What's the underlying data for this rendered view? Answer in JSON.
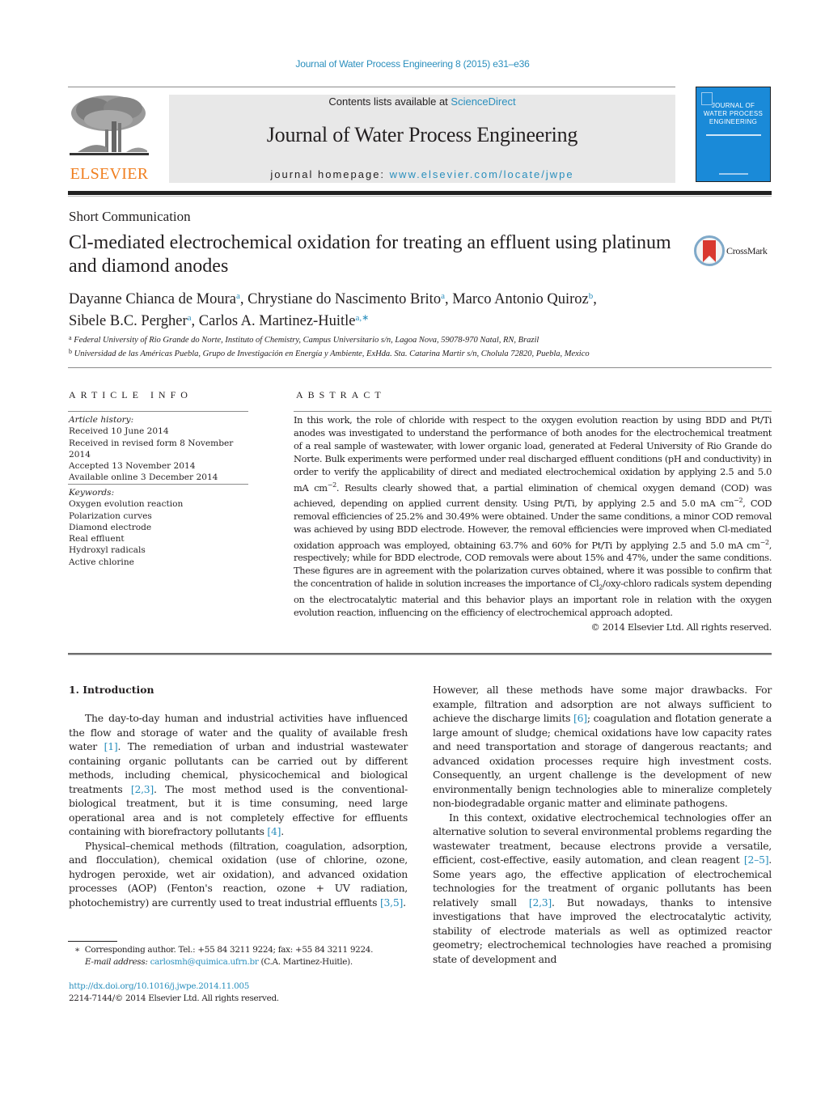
{
  "header": {
    "journal_reference": "Journal of Water Process Engineering 8 (2015) e31–e36",
    "contents_prefix": "Contents lists available at ",
    "contents_link": "ScienceDirect",
    "journal_name": "Journal of Water Process Engineering",
    "homepage_prefix": "journal homepage: ",
    "homepage_url": "www.elsevier.com/locate/jwpe",
    "publisher_logo_text": "ELSEVIER",
    "cover": {
      "title_line1": "JOURNAL OF",
      "title_line2": "WATER PROCESS",
      "title_line3": "ENGINEERING",
      "color": "#1a8ad8"
    },
    "crossmark_label": "CrossMark"
  },
  "article": {
    "type": "Short Communication",
    "title": "Cl-mediated electrochemical oxidation for treating an effluent using platinum and diamond anodes",
    "authors": [
      {
        "name": "Dayanne Chianca de Moura",
        "affil": "a",
        "sep": ", "
      },
      {
        "name": "Chrystiane do Nascimento Brito",
        "affil": "a",
        "sep": ", "
      },
      {
        "name": "Marco Antonio Quiroz",
        "affil": "b",
        "sep": ","
      },
      {
        "name": "Sibele B.C. Pergher",
        "affil": "a",
        "sep": ", "
      },
      {
        "name": "Carlos A. Martinez-Huitle",
        "affil": "a,∗",
        "sep": ""
      }
    ],
    "affiliations": [
      {
        "key": "a",
        "text": "Federal University of Rio Grande do Norte, Instituto of Chemistry, Campus Universitario s/n, Lagoa Nova, 59078-970 Natal, RN, Brazil"
      },
      {
        "key": "b",
        "text": "Universidad de las Américas Puebla, Grupo de Investigación en Energía y Ambiente, ExHda. Sta. Catarina Martir s/n, Cholula 72820, Puebla, Mexico"
      }
    ]
  },
  "article_info": {
    "heading": "ARTICLE INFO",
    "history_label": "Article history:",
    "history": [
      "Received 10 June 2014",
      "Received in revised form 8 November 2014",
      "Accepted 13 November 2014",
      "Available online 3 December 2014"
    ],
    "keywords_label": "Keywords:",
    "keywords": [
      "Oxygen evolution reaction",
      "Polarization curves",
      "Diamond electrode",
      "Real effluent",
      "Hydroxyl radicals",
      "Active chlorine"
    ]
  },
  "abstract": {
    "heading": "ABSTRACT",
    "parts": {
      "p1": "In this work, the role of chloride with respect to the oxygen evolution reaction by using BDD and Pt/Ti anodes was investigated to understand the performance of both anodes for the electrochemical treatment of a real sample of wastewater, with lower organic load, generated at Federal University of Rio Grande do Norte. Bulk experiments were performed under real discharged effluent conditions (pH and conductivity) in order to verify the applicability of direct and mediated electrochemical oxidation by applying 2.5 and 5.0 mA cm",
      "sup1": "−2",
      "p2": ". Results clearly showed that, a partial elimination of chemical oxygen demand (COD) was achieved, depending on applied current density. Using Pt/Ti, by applying 2.5 and 5.0 mA cm",
      "sup2": "−2",
      "p3": ", COD removal efficiencies of 25.2% and 30.49% were obtained. Under the same conditions, a minor COD removal was achieved by using BDD electrode. However, the removal efficiencies were improved when Cl-mediated oxidation approach was employed, obtaining 63.7% and 60% for Pt/Ti by applying 2.5 and 5.0 mA cm",
      "sup3": "−2",
      "p4": ", respectively; while for BDD electrode, COD removals were about 15% and 47%, under the same conditions. These figures are in agreement with the polarization curves obtained, where it was possible to confirm that the concentration of halide in solution increases the importance of Cl",
      "sub1": "2",
      "p5": "/oxy-chloro radicals system depending on the electrocatalytic material and this behavior plays an important role in relation with the oxygen evolution reaction, influencing on the efficiency of electrochemical approach adopted."
    },
    "copyright": "© 2014 Elsevier Ltd. All rights reserved."
  },
  "body": {
    "section_heading": "1.  Introduction",
    "left": {
      "para1": {
        "t1": "The day-to-day human and industrial activities have influenced the flow and storage of water and the quality of available fresh water ",
        "r1": "[1]",
        "t2": ". The remediation of urban and industrial wastewater containing organic pollutants can be carried out by different methods, including chemical, physicochemical and biological treatments ",
        "r2": "[2,3]",
        "t3": ". The most method used is the conventional-biological treatment, but it is time consuming, need large operational area and is not completely effective for effluents containing with biorefractory pollutants ",
        "r3": "[4]",
        "t4": "."
      },
      "para2": {
        "t1": "Physical–chemical methods (filtration, coagulation, adsorption, and flocculation), chemical oxidation (use of chlorine, ozone, hydrogen peroxide, wet air oxidation), and advanced oxidation processes (AOP) (Fenton's reaction, ozone + UV radiation, photochemistry) are currently used to treat industrial effluents ",
        "r1": "[3,5]",
        "t2": "."
      }
    },
    "right": {
      "para1": {
        "t1": "However, all these methods have some major drawbacks. For example, filtration and adsorption are not always sufficient to achieve the discharge limits ",
        "r1": "[6]",
        "t2": "; coagulation and flotation generate a large amount of sludge; chemical oxidations have low capacity rates and need transportation and storage of dangerous reactants; and advanced oxidation processes require high investment costs. Consequently, an urgent challenge is the development of new environmentally benign technologies able to mineralize completely non-biodegradable organic matter and eliminate pathogens."
      },
      "para2": {
        "t1": "In this context, oxidative electrochemical technologies offer an alternative solution to several environmental problems regarding the wastewater treatment, because electrons provide a versatile, efficient, cost-effective, easily automation, and clean reagent ",
        "r1": "[2–5]",
        "t2": ". Some years ago, the effective application of electrochemical technologies for the treatment of organic pollutants has been relatively small ",
        "r2": "[2,3]",
        "t3": ". But nowadays, thanks to intensive investigations that have improved the electrocatalytic activity, stability of electrode materials as well as optimized reactor geometry; electrochemical technologies have reached a promising state of development and"
      }
    }
  },
  "footnote": {
    "marker": "∗",
    "corresponding": "Corresponding author. Tel.: +55 84 3211 9224; fax: +55 84 3211 9224.",
    "email_label": "E-mail address: ",
    "email": "carlosmh@quimica.ufrn.br",
    "email_suffix": " (C.A. Martinez-Huitle).",
    "doi": "http://dx.doi.org/10.1016/j.jwpe.2014.11.005",
    "issn_copyright": "2214-7144/© 2014 Elsevier Ltd. All rights reserved."
  },
  "colors": {
    "link": "#2a8fbd",
    "elsevier_orange": "#f07f20",
    "masthead_gray": "#e8e8e8",
    "crossmark_red": "#d9382f"
  }
}
